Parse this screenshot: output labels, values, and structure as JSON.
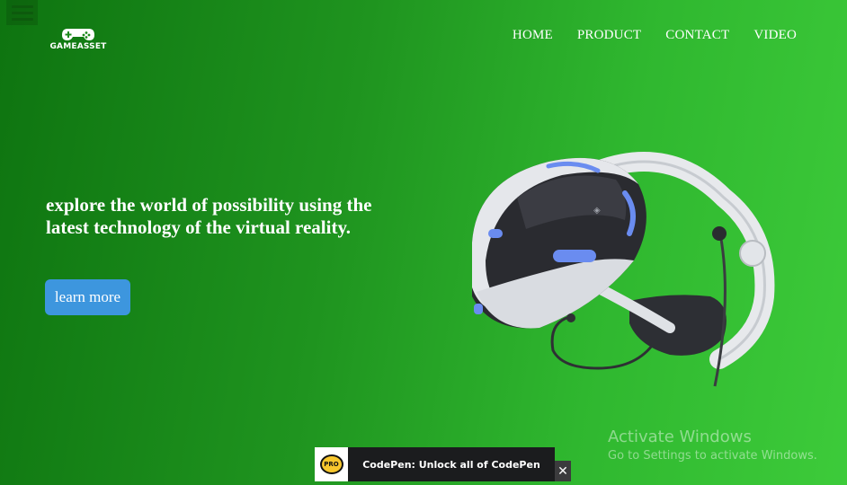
{
  "header": {
    "logo_text": "GAMEASSET",
    "nav": [
      "HOME",
      "PRODUCT",
      "CONTACT",
      "VIDEO"
    ]
  },
  "hero": {
    "headline": "explore the world of possibility using the latest technology of the virtual reality.",
    "cta_label": "learn more"
  },
  "icons": {
    "menu": "hamburger-menu-icon",
    "logo": "gamepad-icon",
    "product": "vr-headset-image",
    "promo": "codepen-pro-icon",
    "close": "close-icon"
  },
  "watermark": {
    "title": "Activate Windows",
    "subtitle": "Go to Settings to activate Windows."
  },
  "promo": {
    "badge_text": "PRO",
    "message": "CodePen: Unlock all of CodePen",
    "close_symbol": "✕"
  },
  "colors": {
    "background_start": "#0e7410",
    "background_end": "#3dcb3a",
    "cta": "#3d96de",
    "accent_blue": "#6a8cf0"
  }
}
